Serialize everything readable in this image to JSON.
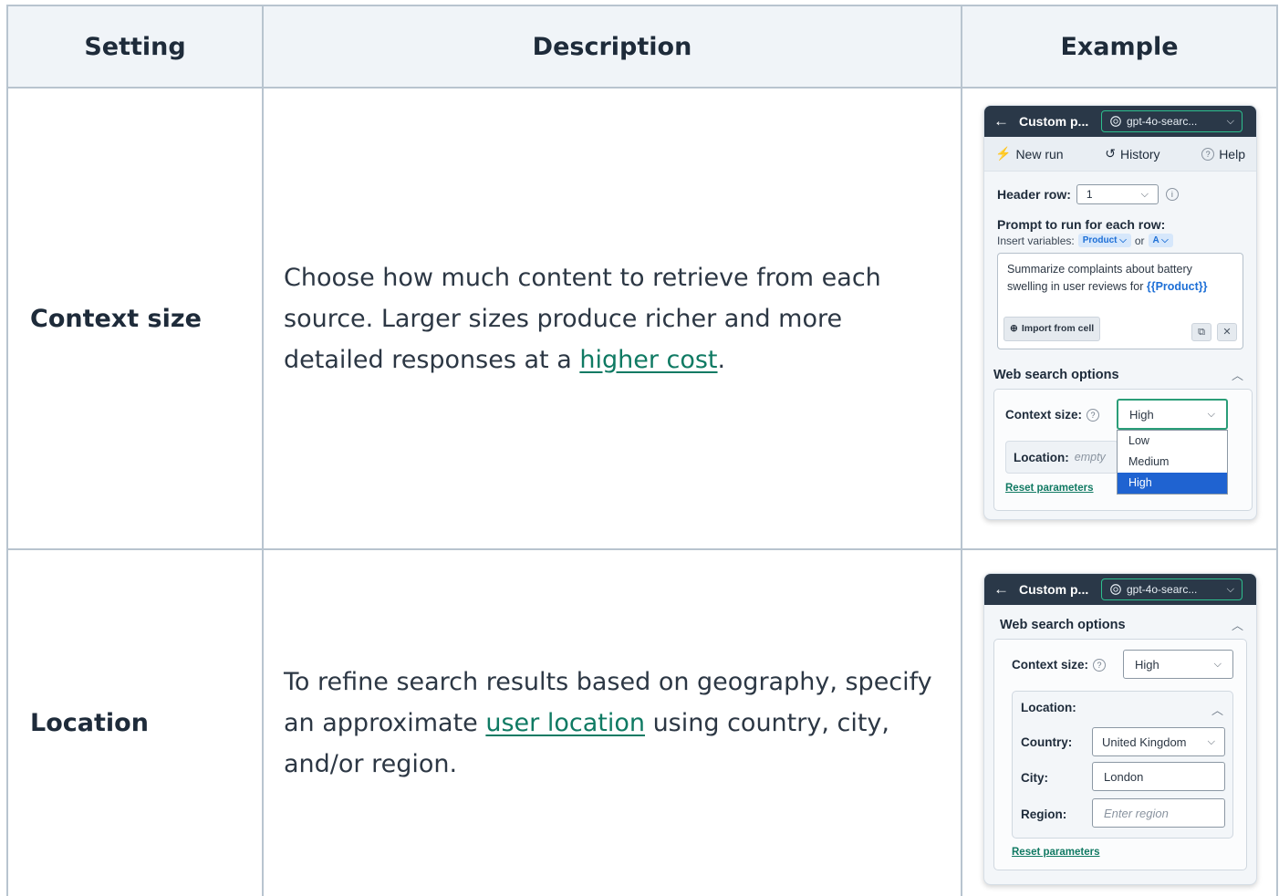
{
  "table": {
    "headers": {
      "setting": "Setting",
      "description": "Description",
      "example": "Example"
    },
    "rows": [
      {
        "setting": "Context size",
        "desc_before": "Choose how much content to retrieve from each source. Larger sizes produce richer and more detailed responses at a ",
        "desc_link": "higher cost",
        "desc_after": "."
      },
      {
        "setting": "Location",
        "desc_before": "To refine search results based on geography, specify an approximate ",
        "desc_link": "user location",
        "desc_after": " using country, city, and/or region."
      }
    ]
  },
  "panel1": {
    "title": "Custom p...",
    "model": "gpt-4o-searc...",
    "nav": {
      "new_run": "New run",
      "history": "History",
      "help": "Help"
    },
    "header_row_label": "Header row:",
    "header_row_value": "1",
    "prompt_label": "Prompt to run for each row:",
    "insert_vars_label": "Insert variables:",
    "var_product": "Product",
    "or": "or",
    "var_a": "A",
    "prompt_text": "Summarize complaints about battery swelling in user reviews for ",
    "prompt_var": "{{Product}}",
    "import_label": "Import from cell",
    "web_search_label": "Web search options",
    "context_size_label": "Context size:",
    "context_size_value": "High",
    "options": [
      "Low",
      "Medium",
      "High"
    ],
    "location_label": "Location:",
    "location_empty": "empty",
    "reset_label": "Reset parameters"
  },
  "panel2": {
    "title": "Custom p...",
    "model": "gpt-4o-searc...",
    "web_search_label": "Web search options",
    "context_size_label": "Context size:",
    "context_size_value": "High",
    "location_label": "Location:",
    "country_label": "Country:",
    "country_value": "United Kingdom",
    "city_label": "City:",
    "city_value": "London",
    "region_label": "Region:",
    "region_placeholder": "Enter region",
    "reset_label": "Reset parameters"
  },
  "colors": {
    "accent": "#2a9d78",
    "link": "#0f7a63",
    "header_bg": "#2a3848",
    "selected": "#1f63d1"
  }
}
